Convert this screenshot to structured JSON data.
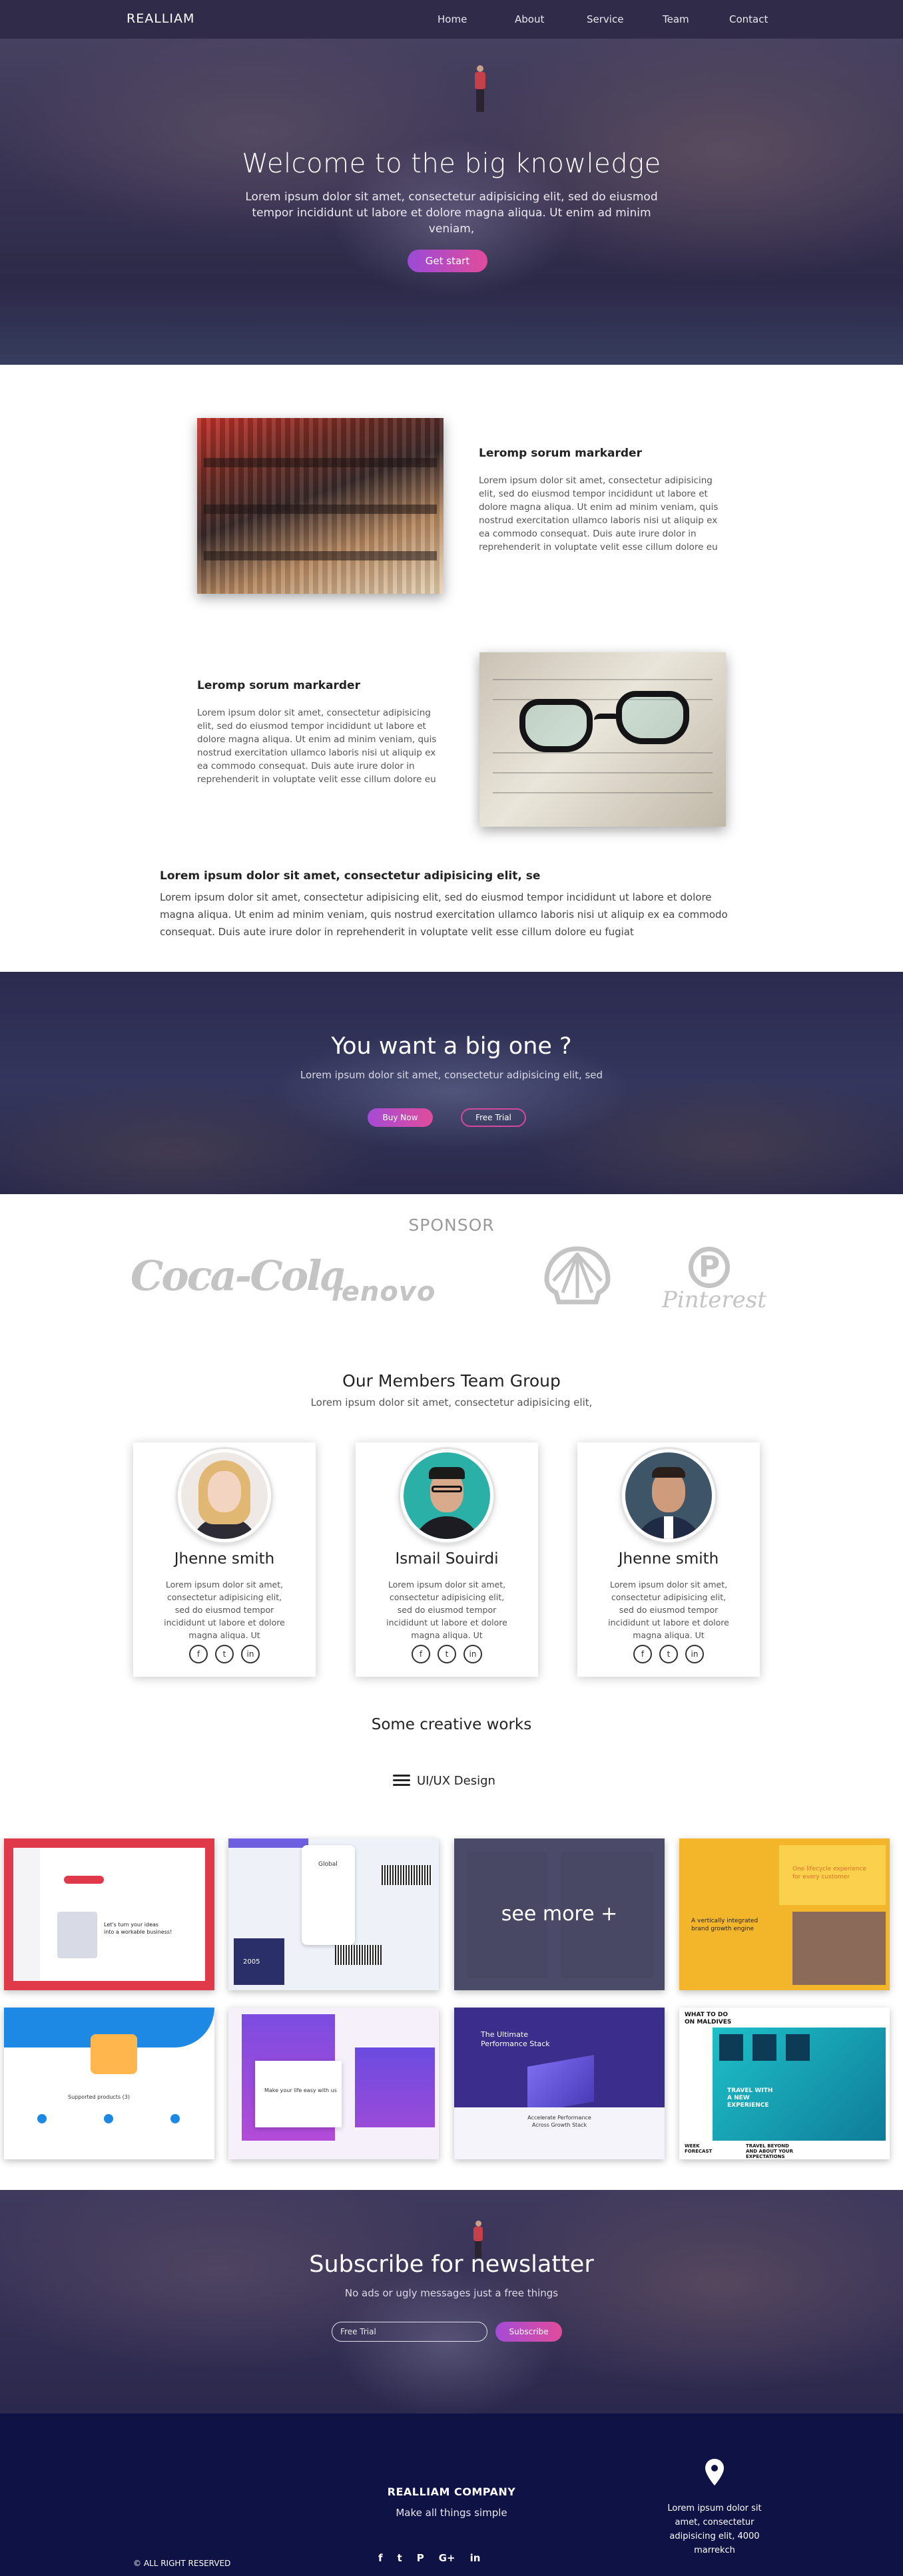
{
  "nav": {
    "brand": "REALLIAM",
    "links": [
      "Home",
      "About",
      "Service",
      "Team",
      "Contact"
    ]
  },
  "hero": {
    "title": "Welcome to the big  knowledge",
    "subtitle": "Lorem ipsum dolor sit amet, consectetur adipisicing elit, sed do eiusmod tempor incididunt ut labore et dolore magna aliqua. Ut enim ad minim veniam,",
    "button": "Get start"
  },
  "features": [
    {
      "heading": "Leromp sorum markarder",
      "text": "Lorem ipsum dolor sit amet, consectetur adipisicing elit, sed do eiusmod tempor incididunt ut labore et dolore magna aliqua. Ut enim ad minim veniam, quis nostrud exercitation ullamco laboris nisi ut aliquip ex ea commodo consequat. Duis aute irure dolor in reprehenderit in voluptate velit esse cillum dolore eu"
    },
    {
      "heading": "Leromp sorum markarder",
      "text": "Lorem ipsum dolor sit amet, consectetur adipisicing elit, sed do eiusmod tempor incididunt ut labore et dolore magna aliqua. Ut enim ad minim veniam, quis nostrud exercitation ullamco laboris nisi ut aliquip ex ea commodo consequat. Duis aute irure dolor in reprehenderit in voluptate velit esse cillum dolore eu"
    }
  ],
  "lorem": {
    "heading": "Lorem ipsum dolor sit amet, consectetur adipisicing elit, se",
    "text": "Lorem ipsum dolor sit amet, consectetur adipisicing elit, sed do eiusmod tempor incididunt ut labore et dolore magna aliqua. Ut enim ad minim veniam, quis nostrud exercitation ullamco laboris nisi ut aliquip ex ea commodo consequat. Duis aute irure dolor in reprehenderit in voluptate velit esse cillum dolore eu fugiat"
  },
  "cta": {
    "title": "You want a big one ?",
    "subtitle": "Lorem ipsum dolor sit amet, consectetur adipisicing elit, sed",
    "buy_button": "Buy Now",
    "free_button": "Free Trial"
  },
  "sponsor": {
    "heading": "SPONSOR",
    "logos": [
      "Coca-Cola",
      "lenovo",
      "Shell",
      "Pinterest"
    ]
  },
  "team": {
    "heading": "Our Members Team Group",
    "subtitle": "Lorem ipsum dolor sit amet, consectetur adipisicing elit,",
    "members": [
      {
        "name": "Jhenne smith",
        "bio": "Lorem ipsum dolor sit amet, consectetur adipisicing elit, sed do eiusmod tempor incididunt ut labore et dolore magna aliqua. Ut"
      },
      {
        "name": "Ismail Souirdi",
        "bio": "Lorem ipsum dolor sit amet, consectetur adipisicing elit, sed do eiusmod tempor incididunt ut labore et dolore magna aliqua. Ut"
      },
      {
        "name": "Jhenne smith",
        "bio": "Lorem ipsum dolor sit amet, consectetur adipisicing elit, sed do eiusmod tempor incididunt ut labore et dolore magna aliqua. Ut"
      }
    ],
    "social_icons": [
      "f",
      "t",
      "in"
    ]
  },
  "works": {
    "heading": "Some creative works",
    "filter": "UI/UX Design",
    "see_more": "see more +",
    "tiles": [
      {
        "lines": [
          "Let's turn your ideas",
          "into a workable business!"
        ]
      },
      {
        "lines": [
          "Global",
          "2005"
        ]
      },
      {
        "lines": []
      },
      {
        "lines": [
          "One lifecycle experience",
          "for every customer",
          "A vertically integrated",
          "brand growth engine"
        ]
      },
      {
        "lines": [
          "Supported products (3)"
        ]
      },
      {
        "lines": [
          "Make your life easy with us"
        ]
      },
      {
        "lines": [
          "The Ultimate",
          "Performance Stack",
          "Accelerate Performance",
          "Across Growth Stack"
        ]
      },
      {
        "lines": [
          "WHAT TO DO",
          "ON MALDIVES",
          "TRAVEL WITH",
          "A NEW",
          "EXPERIENCE",
          "TRAVEL BEYOND",
          "AND ABOUT YOUR",
          "EXPECTATIONS",
          "WEEK",
          "FORECAST"
        ]
      }
    ]
  },
  "newsletter": {
    "title": "Subscribe for newslatter",
    "subtitle": "No ads or ugly messages just a free things",
    "input_placeholder": "Free Trial",
    "button": "Subscribe"
  },
  "footer": {
    "company": "REALLIAM COMPANY",
    "tagline": "Make all things simple",
    "rights": "© ALL RIGHT RESERVED",
    "socials": [
      "f",
      "t",
      "P",
      "G+",
      "in"
    ],
    "address": "Lorem ipsum dolor sit amet, consectetur adipisicing elit, 4000 marrekch"
  },
  "colors": {
    "nav_bg": "#2f2b49",
    "accent_gradient_start": "#9b4ad8",
    "accent_gradient_end": "#e04c9b",
    "footer_bg": "#0e1244"
  }
}
